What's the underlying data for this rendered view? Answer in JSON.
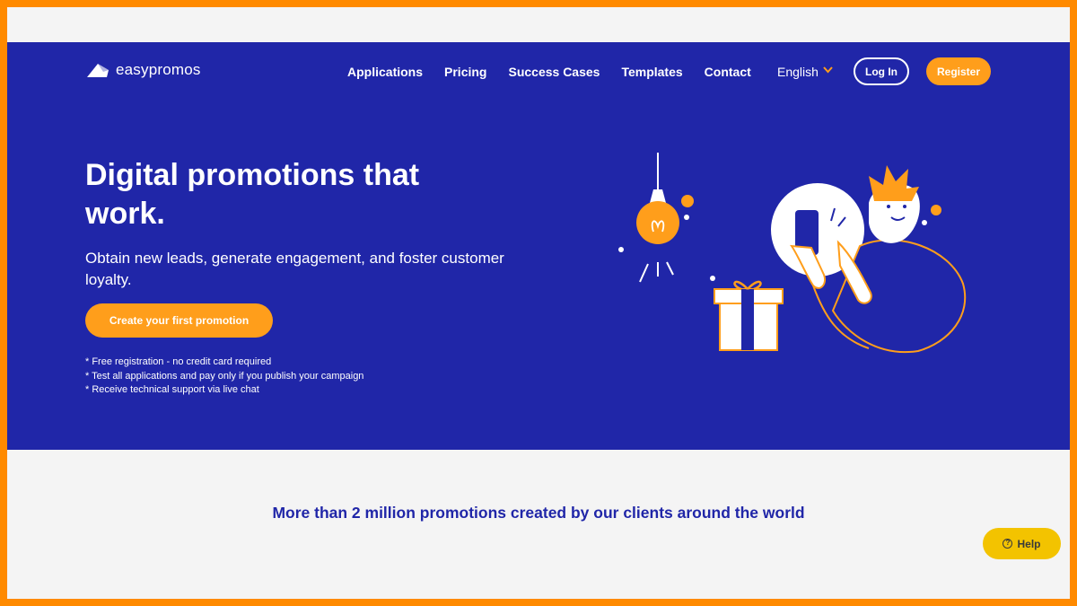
{
  "brand": {
    "name": "easypromos",
    "icon": "easypromos-logo-icon"
  },
  "nav": {
    "items": [
      "Applications",
      "Pricing",
      "Success Cases",
      "Templates",
      "Contact"
    ],
    "language": "English",
    "language_icon": "chevron-down-icon",
    "login_label": "Log In",
    "register_label": "Register"
  },
  "hero": {
    "title": "Digital promotions that work.",
    "subtitle": "Obtain new leads, generate engagement, and foster customer loyalty.",
    "cta_label": "Create your first promotion",
    "notes": [
      "* Free registration - no credit card required",
      "* Test all applications and pay only if you publish your campaign",
      "* Receive technical support via live chat"
    ]
  },
  "stats_text": "More than 2 million promotions created by our clients around the world",
  "help": {
    "label": "Help",
    "icon": "question-icon"
  },
  "colors": {
    "hero_bg": "#2026a8",
    "accent": "#ff9e1b",
    "frame": "#ff8a00",
    "help_bg": "#f3c300",
    "page_bg": "#f4f4f4"
  }
}
